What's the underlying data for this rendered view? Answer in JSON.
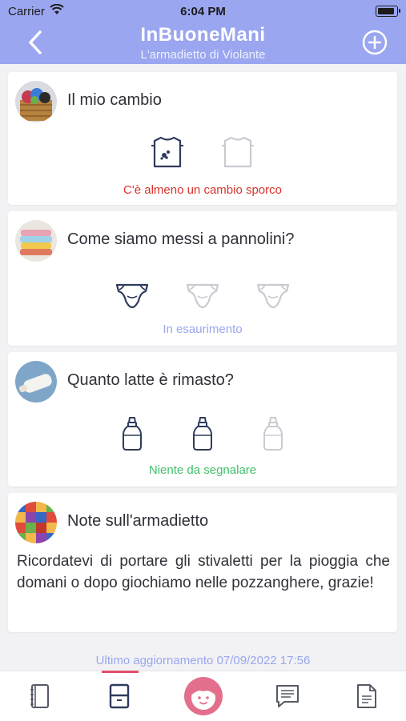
{
  "status_bar": {
    "carrier": "Carrier",
    "time": "6:04 PM",
    "battery_level": 0.9
  },
  "header": {
    "title": "InBuoneMani",
    "subtitle": "L'armadietto di Violante"
  },
  "cards": {
    "change": {
      "title": "Il mio cambio",
      "status": "C'è almeno un cambio sporco",
      "status_color": "#d9322b"
    },
    "diapers": {
      "title": "Come siamo messi a pannolini?",
      "status": "In esaurimento",
      "status_color": "#9aa6ef"
    },
    "milk": {
      "title": "Quanto latte è rimasto?",
      "status": "Niente da segnalare",
      "status_color": "#3fbf6b"
    },
    "notes": {
      "title": "Note sull'armadietto",
      "text": "Ricordatevi di portare gli stivaletti per la pioggia che domani o dopo giochiamo nelle pozzanghere, grazie!"
    }
  },
  "last_update": "Ultimo aggiornamento 07/09/2022 17:56",
  "tabbar": {
    "active_tab": "locker",
    "tabs": [
      "diary-icon",
      "locker-icon",
      "child-avatar-icon",
      "messages-icon",
      "document-icon"
    ]
  },
  "colors": {
    "accent": "#9aa6ef",
    "pink": "#e36f8c",
    "dark_icon": "#2f3b5c",
    "light_icon": "#c9cbd2"
  }
}
